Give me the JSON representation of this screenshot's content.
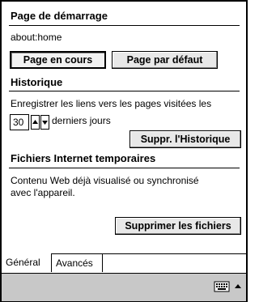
{
  "startup": {
    "title": "Page de démarrage",
    "url": "about:home",
    "current_page_button": "Page en cours",
    "default_page_button": "Page par défaut"
  },
  "history": {
    "title": "Historique",
    "description": "Enregistrer les liens vers les pages visitées les",
    "days_value": "30",
    "days_suffix": "derniers jours",
    "clear_button": "Suppr. l'Historique"
  },
  "temp_files": {
    "title": "Fichiers Internet temporaires",
    "description_line1": "Contenu Web déjà visualisé ou synchronisé",
    "description_line2": "avec l'appareil.",
    "delete_button": "Supprimer les fichiers"
  },
  "tabs": [
    {
      "label": "Général",
      "active": true
    },
    {
      "label": "Avancés",
      "active": false
    }
  ],
  "taskbar": {
    "keyboard_icon": "keyboard-icon",
    "input_menu_icon": "up-arrow-icon"
  }
}
